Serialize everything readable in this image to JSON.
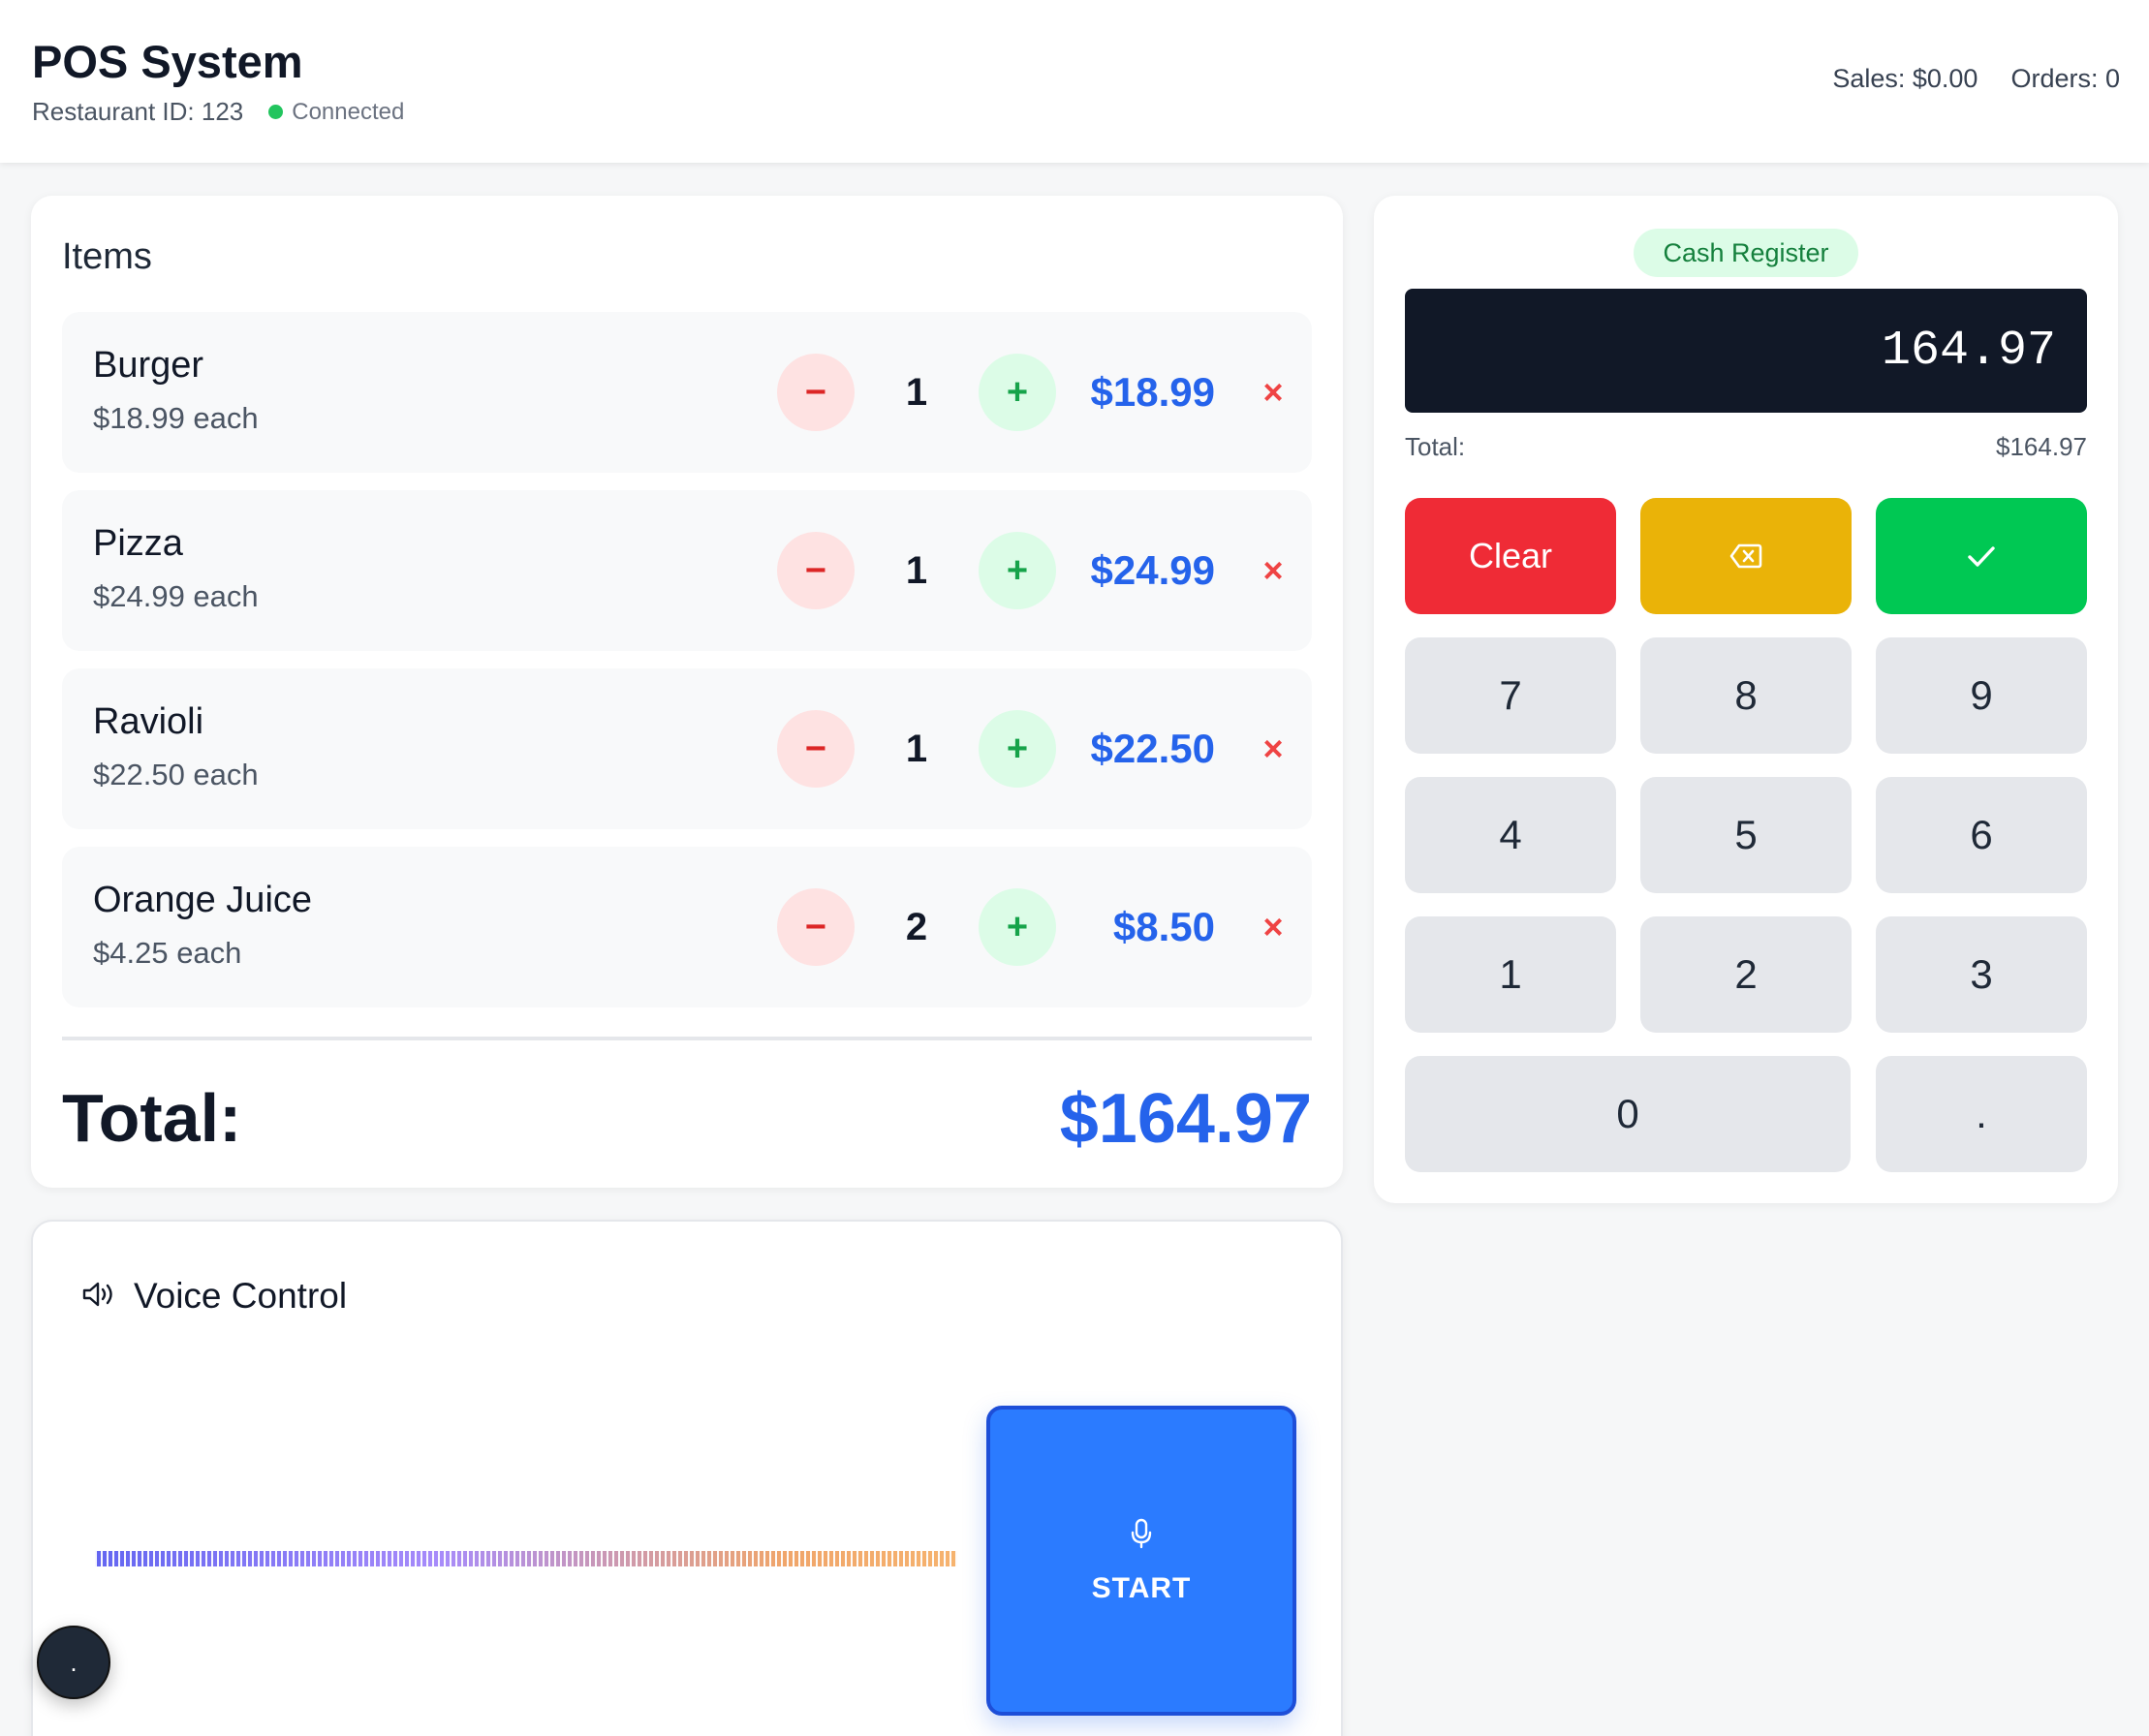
{
  "header": {
    "title": "POS System",
    "restaurant": "Restaurant ID: 123",
    "status": "Connected",
    "sales": "Sales: $0.00",
    "orders": "Orders: 0"
  },
  "items": {
    "heading": "Items",
    "list": [
      {
        "name": "Burger",
        "each": "$18.99 each",
        "qty": "1",
        "total": "$18.99"
      },
      {
        "name": "Pizza",
        "each": "$24.99 each",
        "qty": "1",
        "total": "$24.99"
      },
      {
        "name": "Ravioli",
        "each": "$22.50 each",
        "qty": "1",
        "total": "$22.50"
      },
      {
        "name": "Orange Juice",
        "each": "$4.25 each",
        "qty": "2",
        "total": "$8.50"
      }
    ],
    "minus_symbol": "−",
    "plus_symbol": "+",
    "remove_symbol": "×",
    "total_label": "Total:",
    "total_value": "$164.97"
  },
  "register": {
    "badge": "Cash Register",
    "display": "164.97",
    "total_label": "Total:",
    "total_value": "$164.97",
    "clear_label": "Clear",
    "backspace_icon": "backspace-icon",
    "confirm_icon": "check-icon",
    "keys": [
      "7",
      "8",
      "9",
      "4",
      "5",
      "6",
      "1",
      "2",
      "3",
      "0",
      "."
    ]
  },
  "voice": {
    "title": "Voice Control",
    "speaker_icon": "speaker-icon",
    "mic_icon": "microphone-icon",
    "start_label": "START",
    "floating_label": "."
  },
  "colors": {
    "accent_blue": "#2563eb",
    "clear_red": "#ef2b36",
    "backspace_yellow": "#eab308",
    "confirm_green": "#00c853",
    "display_dark": "#111827",
    "status_green": "#22c55e"
  }
}
